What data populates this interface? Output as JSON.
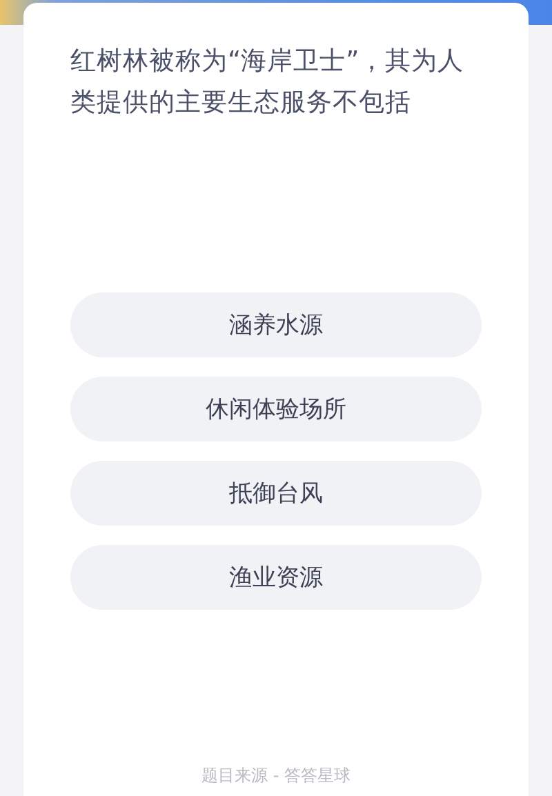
{
  "question": "红树林被称为“海岸卫士”，其为人类提供的主要生态服务不包括",
  "options": [
    {
      "label": "涵养水源"
    },
    {
      "label": "休闲体验场所"
    },
    {
      "label": "抵御台风"
    },
    {
      "label": "渔业资源"
    }
  ],
  "footer": "题目来源 - 答答星球"
}
